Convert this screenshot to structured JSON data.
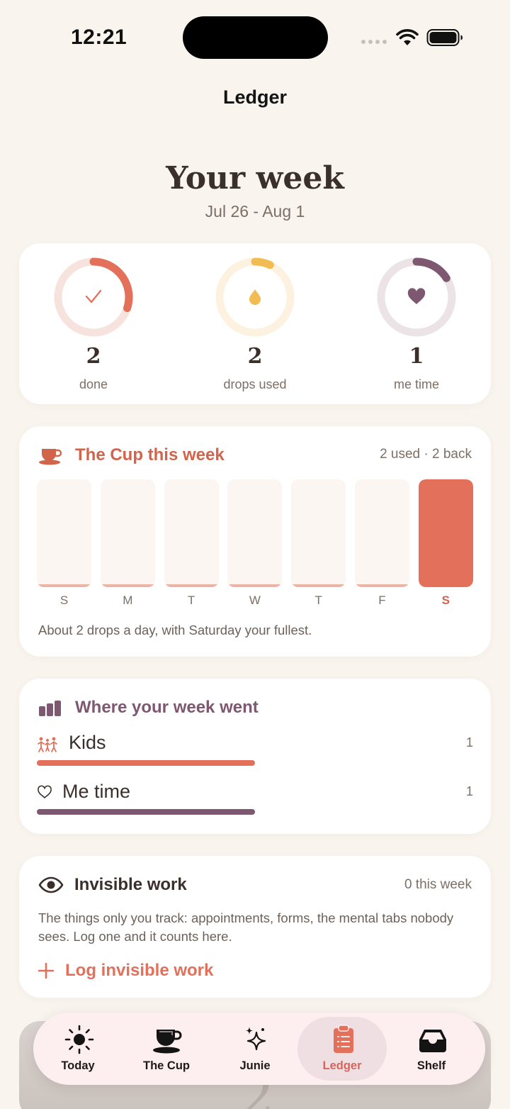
{
  "status_bar": {
    "time": "12:21"
  },
  "nav": {
    "title": "Ledger"
  },
  "header": {
    "title": "Your week",
    "date_range": "Jul 26 - Aug 1"
  },
  "stats": [
    {
      "value": "2",
      "label": "done",
      "icon": "check-icon",
      "progress": 0.3,
      "color": "#e2705a",
      "track": "#f7e3dd"
    },
    {
      "value": "2",
      "label": "drops used",
      "icon": "drop-icon",
      "progress": 0.07,
      "color": "#f1bd52",
      "track": "#fdf2df"
    },
    {
      "value": "1",
      "label": "me time",
      "icon": "heart-icon",
      "progress": 0.16,
      "color": "#7d5870",
      "track": "#ebe3e6"
    }
  ],
  "cup": {
    "title": "The Cup this week",
    "meta": "2 used · 2 back",
    "days": [
      "S",
      "M",
      "T",
      "W",
      "T",
      "F",
      "S"
    ],
    "drops": [
      0,
      0,
      0,
      0,
      0,
      0,
      2
    ],
    "active_index": 6,
    "summary": "About 2 drops a day, with Saturday your fullest."
  },
  "where": {
    "title": "Where your week went",
    "rows": [
      {
        "label": "Kids",
        "count": "1",
        "icon": "people-icon",
        "color": "#e2705a",
        "fraction": 0.5
      },
      {
        "label": "Me time",
        "count": "1",
        "icon": "heart-outline-icon",
        "color": "#7d5870",
        "fraction": 0.5
      }
    ]
  },
  "invisible": {
    "title": "Invisible work",
    "meta": "0 this week",
    "description": "The things only you track: appointments, forms, the mental tabs nobody sees. Log one and it counts here.",
    "action_label": "Log invisible work"
  },
  "tabs": [
    {
      "label": "Today",
      "icon": "sun-icon"
    },
    {
      "label": "The Cup",
      "icon": "cup-icon"
    },
    {
      "label": "Junie",
      "icon": "sparkles-icon"
    },
    {
      "label": "Ledger",
      "icon": "clipboard-icon",
      "active": true
    },
    {
      "label": "Shelf",
      "icon": "tray-icon"
    }
  ],
  "peek": {
    "number": "2"
  },
  "colors": {
    "accent": "#e2705a",
    "plum": "#7d5870",
    "gold": "#f1bd52",
    "background": "#f9f4ee"
  }
}
